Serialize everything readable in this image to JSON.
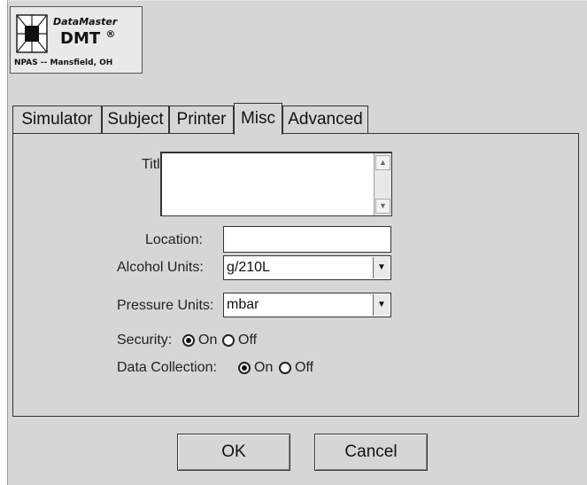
{
  "logo": {
    "brand": "DataMaster",
    "model": "DMT",
    "registered": "®",
    "site": "NPAS -- Mansfield, OH"
  },
  "tabs": [
    {
      "label": "Simulator",
      "active": false
    },
    {
      "label": "Subject",
      "active": false
    },
    {
      "label": "Printer",
      "active": false
    },
    {
      "label": "Misc",
      "active": true
    },
    {
      "label": "Advanced",
      "active": false
    }
  ],
  "form": {
    "title_label": "Title:",
    "title_value": "",
    "location_label": "Location:",
    "location_value": "",
    "alcohol_units_label": "Alcohol Units:",
    "alcohol_units_value": "g/210L",
    "pressure_units_label": "Pressure Units:",
    "pressure_units_value": "mbar",
    "security_label": "Security:",
    "security_on_label": "On",
    "security_off_label": "Off",
    "security_value": "On",
    "data_collection_label": "Data Collection:",
    "data_collection_on_label": "On",
    "data_collection_off_label": "Off",
    "data_collection_value": "On"
  },
  "buttons": {
    "ok_label": "OK",
    "cancel_label": "Cancel"
  }
}
